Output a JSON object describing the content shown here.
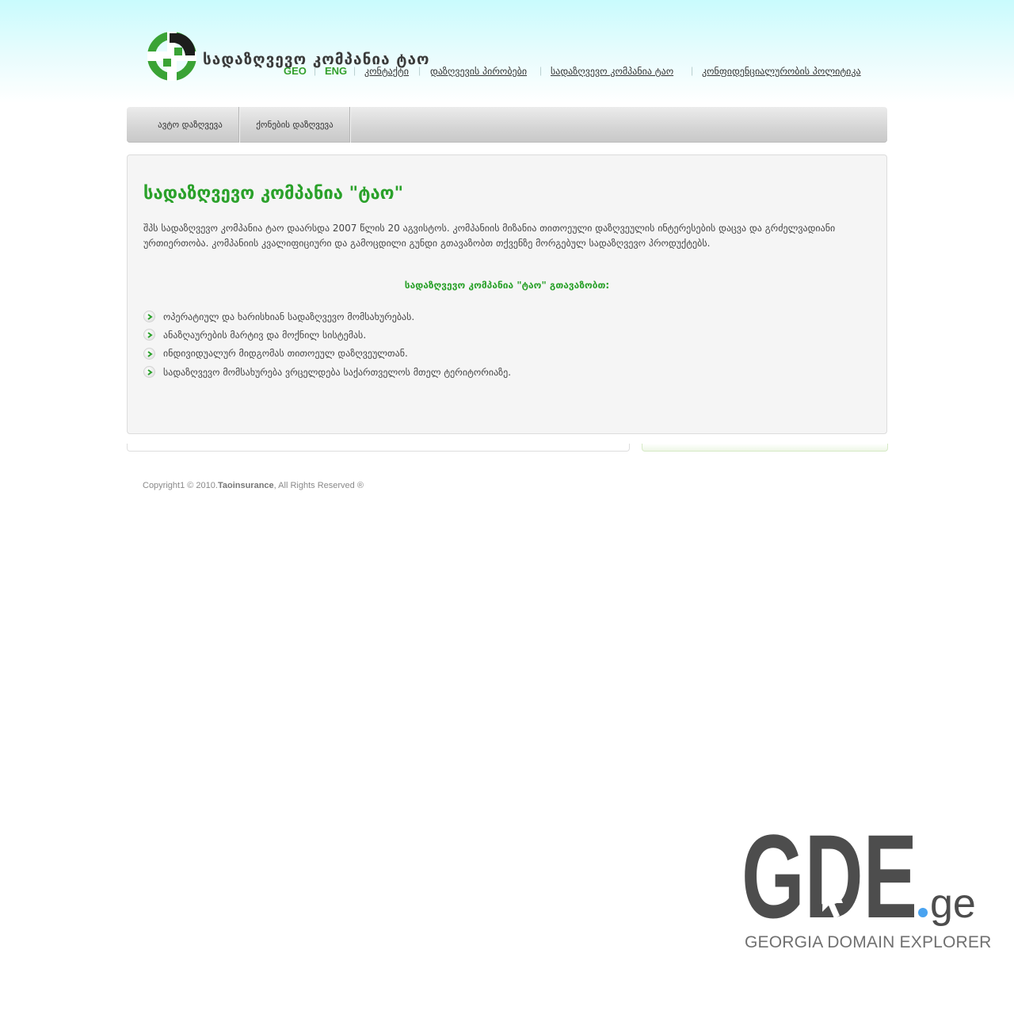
{
  "header": {
    "logo_text": "სადაზღვევო კომპანია ტაო",
    "lang": [
      "GEO",
      "ENG"
    ],
    "links": [
      "კონტაქტი",
      "დაზღვევის პირობები",
      "სადაზღვევო კომპანია ტაო",
      "კონფიდენციალურობის პოლიტიკა"
    ]
  },
  "nav": {
    "items": [
      "ავტო დაზღვევა",
      "ქონების დაზღვევა"
    ]
  },
  "main": {
    "title": "სადაზღვევო კომპანია \"ტაო\"",
    "intro": "შპს სადაზღვევო კომპანია ტაო დაარსდა 2007 წლის 20 აგვისტოს. კომპანიის მიზანია თითოეული დაზღვეულის ინტერესების დაცვა და გრძელვადიანი ურთიერთობა. კომპანიის კვალიფიციური და გამოცდილი გუნდი გთავაზობთ თქვენზე მორგებულ სადაზღვევო პროდუქტებს.",
    "subhead": "სადაზღვევო კომპანია \"ტაო\" გთავაზობთ:",
    "bullets": [
      "ოპერატიულ და ხარისხიან სადაზღვევო მომსახურებას.",
      "ანაზღაურების მარტივ და მოქნილ სისტემას.",
      "ინდივიდუალურ მიდგომას თითოეულ დაზღვეულთან.",
      "სადაზღვევო მომსახურება ვრცელდება საქართველოს მთელ ტერიტორიაზე."
    ]
  },
  "footer": {
    "copyright_prefix": "Copyright1 © 2010.",
    "brand": "Taoinsurance",
    "copyright_suffix": ", All Rights Reserved ®"
  },
  "watermark": {
    "name": "GDE",
    "tld": ".ge",
    "subtitle": "GEORGIA DOMAIN EXPLORER"
  },
  "colors": {
    "accent_green": "#2aa12a",
    "logo_dark": "#1d1d1d",
    "watermark_gray": "#4d4d4d",
    "watermark_dot": "#4aa3f0"
  }
}
